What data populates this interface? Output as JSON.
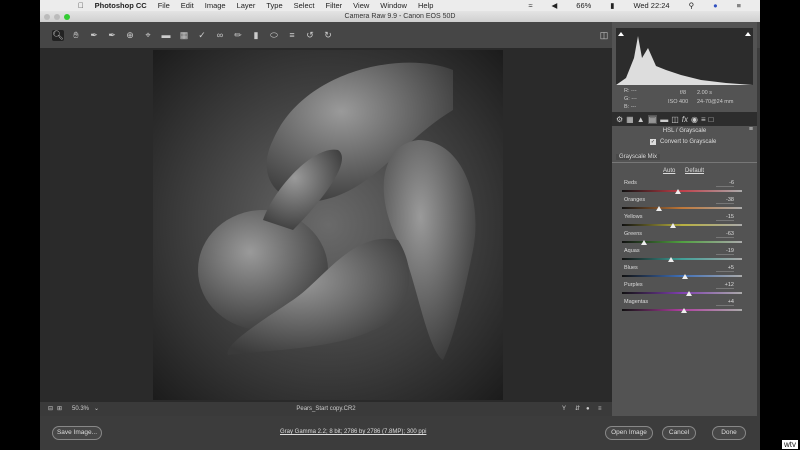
{
  "menubar": {
    "app": "Photoshop CC",
    "items": [
      "File",
      "Edit",
      "Image",
      "Layer",
      "Type",
      "Select",
      "Filter",
      "View",
      "Window",
      "Help"
    ],
    "battery": "66%",
    "clock": "Wed 22:24"
  },
  "window": {
    "title": "Camera Raw 9.9  -  Canon EOS 50D"
  },
  "info": {
    "r": "R:  ---",
    "g": "G:  ---",
    "b": "B:  ---",
    "aperture": "f/8",
    "shutter": "2.00 s",
    "iso": "ISO 400",
    "lens": "24-70@24 mm"
  },
  "panel": {
    "title": "HSL / Grayscale",
    "convert_label": "Convert to Grayscale",
    "convert_checked": true,
    "subtab": "Grayscale Mix",
    "auto": "Auto",
    "default": "Default",
    "sliders": [
      {
        "label": "Reds",
        "value": "-6",
        "num": -6,
        "color": "#c0404a"
      },
      {
        "label": "Oranges",
        "value": "-38",
        "num": -38,
        "color": "#c0783a"
      },
      {
        "label": "Yellows",
        "value": "-15",
        "num": -15,
        "color": "#b8b040"
      },
      {
        "label": "Greens",
        "value": "-63",
        "num": -63,
        "color": "#50a040"
      },
      {
        "label": "Aquas",
        "value": "-19",
        "num": -19,
        "color": "#40a098"
      },
      {
        "label": "Blues",
        "value": "+5",
        "num": 5,
        "color": "#4070b8"
      },
      {
        "label": "Purples",
        "value": "+12",
        "num": 12,
        "color": "#8040b0"
      },
      {
        "label": "Magentas",
        "value": "+4",
        "num": 4,
        "color": "#b040a0"
      }
    ]
  },
  "status": {
    "zoom": "50.3%",
    "filename": "Pears_Start copy.CR2"
  },
  "buttons": {
    "save": "Save Image...",
    "workflow": "Gray Gamma 2.2; 8 bit; 2786 by 2786 (7.8MP); 300 ppi",
    "open": "Open Image",
    "cancel": "Cancel",
    "done": "Done"
  },
  "watermark": "wtv"
}
